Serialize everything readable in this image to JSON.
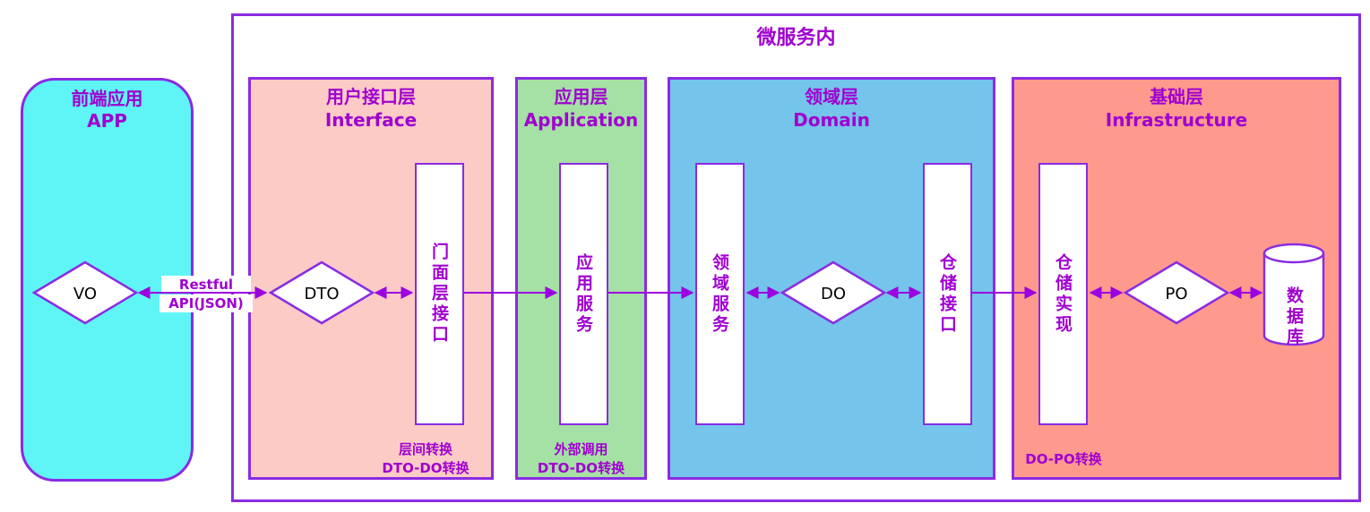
{
  "frontend": {
    "title": "前端应用",
    "subtitle": "APP",
    "vo_label": "VO"
  },
  "connection": {
    "line1": "Restful",
    "line2": "API(JSON)"
  },
  "microservice": {
    "title": "微服务内"
  },
  "layers": {
    "interface": {
      "title": "用户接口层",
      "subtitle": "Interface",
      "dto_label": "DTO",
      "box_label": "门面层接口",
      "note1": "层间转换",
      "note2": "DTO-DO转换"
    },
    "application": {
      "title": "应用层",
      "subtitle": "Application",
      "box_label": "应用服务",
      "note1": "外部调用",
      "note2": "DTO-DO转换"
    },
    "domain": {
      "title": "领域层",
      "subtitle": "Domain",
      "box1_label": "领域服务",
      "do_label": "DO",
      "box2_label": "仓储接口"
    },
    "infrastructure": {
      "title": "基础层",
      "subtitle": "Infrastructure",
      "box_label": "仓储实现",
      "po_label": "PO",
      "db_label": "数据库",
      "note": "DO-PO转换"
    }
  },
  "colors": {
    "frontend_bg": "#5ff5f7",
    "interface_bg": "#fdcbc6",
    "application_bg": "#a5e0a5",
    "domain_bg": "#74c4ec",
    "infrastructure_bg": "#fe9a8d",
    "border": "#8a2be2",
    "text": "#a000d0"
  }
}
